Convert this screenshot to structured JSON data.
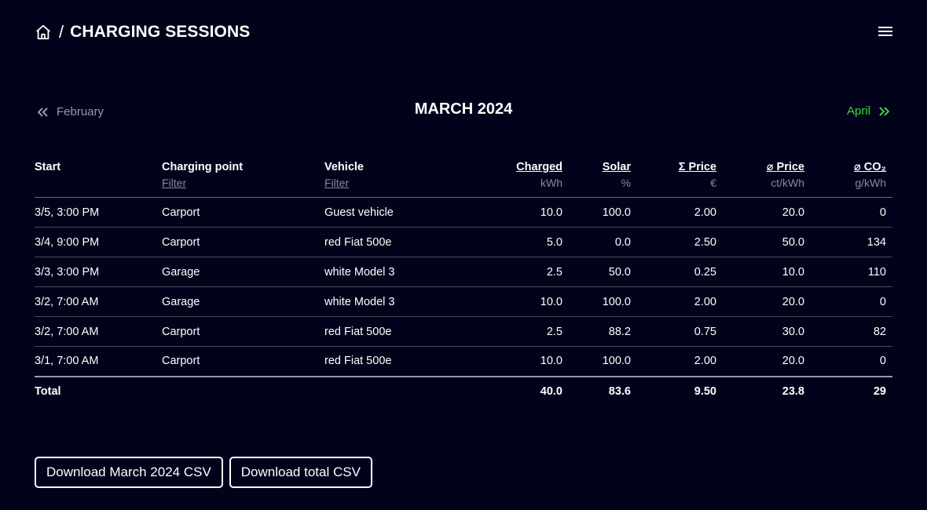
{
  "header": {
    "separator": "/",
    "title": "CHARGING SESSIONS"
  },
  "nav": {
    "prev_label": "February",
    "month_title": "MARCH 2024",
    "next_label": "April"
  },
  "colors": {
    "background": "#02021a",
    "accent": "#3fd33f",
    "muted": "#8a8a98"
  },
  "table": {
    "columns": [
      {
        "label": "Start",
        "sub": ""
      },
      {
        "label": "Charging point",
        "sub": "Filter"
      },
      {
        "label": "Vehicle",
        "sub": "Filter"
      },
      {
        "label": "Charged",
        "sub": "kWh"
      },
      {
        "label": "Solar",
        "sub": "%"
      },
      {
        "label": "Σ Price",
        "sub": "€"
      },
      {
        "label": "⌀ Price",
        "sub": "ct/kWh"
      },
      {
        "label": "⌀ CO₂",
        "sub": "g/kWh"
      }
    ],
    "rows": [
      [
        "3/5, 3:00 PM",
        "Carport",
        "Guest vehicle",
        "10.0",
        "100.0",
        "2.00",
        "20.0",
        "0"
      ],
      [
        "3/4, 9:00 PM",
        "Carport",
        "red Fiat 500e",
        "5.0",
        "0.0",
        "2.50",
        "50.0",
        "134"
      ],
      [
        "3/3, 3:00 PM",
        "Garage",
        "white Model 3",
        "2.5",
        "50.0",
        "0.25",
        "10.0",
        "110"
      ],
      [
        "3/2, 7:00 AM",
        "Garage",
        "white Model 3",
        "10.0",
        "100.0",
        "2.00",
        "20.0",
        "0"
      ],
      [
        "3/2, 7:00 AM",
        "Carport",
        "red Fiat 500e",
        "2.5",
        "88.2",
        "0.75",
        "30.0",
        "82"
      ],
      [
        "3/1, 7:00 AM",
        "Carport",
        "red Fiat 500e",
        "10.0",
        "100.0",
        "2.00",
        "20.0",
        "0"
      ]
    ],
    "total": [
      "Total",
      "",
      "",
      "40.0",
      "83.6",
      "9.50",
      "23.8",
      "29"
    ]
  },
  "downloads": {
    "month_csv": "Download March 2024 CSV",
    "total_csv": "Download total CSV"
  },
  "icons": {
    "home": "home-icon",
    "menu": "hamburger-menu-icon",
    "prev": "double-chevron-left-icon",
    "next": "double-chevron-right-icon"
  }
}
